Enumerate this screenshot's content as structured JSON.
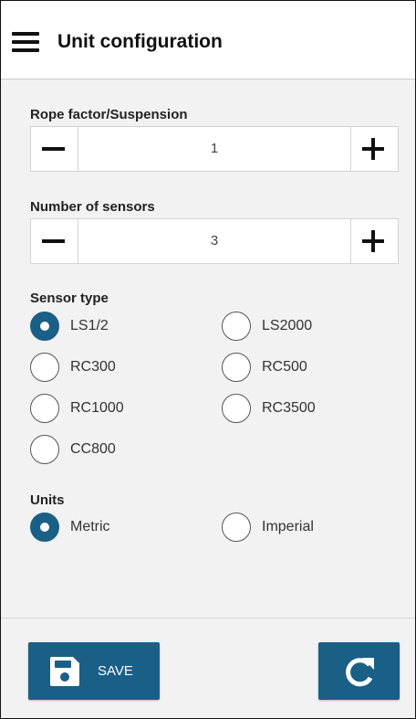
{
  "header": {
    "title": "Unit configuration",
    "menu_icon": "hamburger-menu-icon"
  },
  "rope_factor": {
    "label": "Rope factor/Suspension",
    "value": "1",
    "decrement_icon": "minus-icon",
    "increment_icon": "plus-icon"
  },
  "num_sensors": {
    "label": "Number of sensors",
    "value": "3",
    "decrement_icon": "minus-icon",
    "increment_icon": "plus-icon"
  },
  "sensor_type": {
    "label": "Sensor type",
    "selected": "LS1/2",
    "options": [
      "LS1/2",
      "LS2000",
      "RC300",
      "RC500",
      "RC1000",
      "RC3500",
      "CC800"
    ]
  },
  "units": {
    "label": "Units",
    "selected": "Metric",
    "options": [
      "Metric",
      "Imperial"
    ]
  },
  "footer": {
    "save_label": "SAVE",
    "save_icon": "floppy-disk-icon",
    "refresh_icon": "refresh-icon"
  },
  "colors": {
    "accent": "#1a5f85",
    "background": "#f2f2f2",
    "header": "#ffffff"
  }
}
